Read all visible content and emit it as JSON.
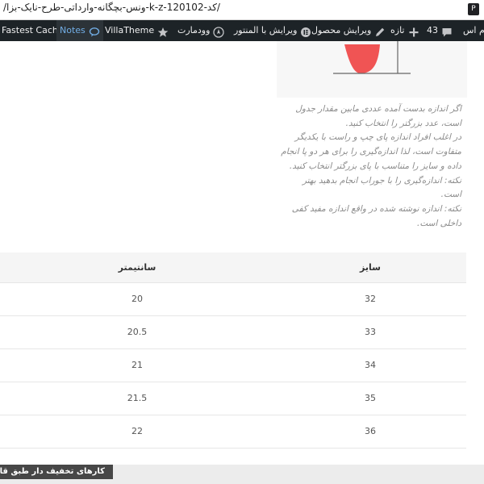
{
  "browser": {
    "url": "/کد-120102-k-z-ونس-بچگانه-وارداتی-طرح-نایک-بزا/"
  },
  "adminbar": {
    "items": [
      {
        "label": "Fastest Cache",
        "icon": ""
      },
      {
        "label": "Notes",
        "icon": "speech-bubble-icon"
      },
      {
        "label": "VillaTheme",
        "icon": "star-icon"
      },
      {
        "label": "وودمارت",
        "icon": "compass-icon"
      },
      {
        "label": "ویرایش با المنتور",
        "icon": "elementor-icon"
      },
      {
        "label": "ویرایش محصول",
        "icon": "pencil-icon"
      },
      {
        "label": "تازه",
        "icon": "plus-icon"
      },
      {
        "label": "43",
        "icon": "comment-icon"
      },
      {
        "label": "ام اس",
        "icon": ""
      }
    ]
  },
  "description": [
    "اگر اندازه بدست آمده عددی مابین مقدار جدول",
    "است، عدد بزرگتر را انتخاب کنید.",
    "در اغلب افراد اندازه پای چپ و راست با یکدیگر",
    "متفاوت است، لذا اندازه‌گیری را برای هر دو پا انجام",
    "داده و سایز را متناسب با پای بزرگتر انتخاب کنید.",
    "نکته: اندازه‌گیری را با جوراب انجام بدهید بهتر",
    "است.",
    "نکته: اندازه نوشته شده در واقع اندازه مفید کفی",
    "داخلی است."
  ],
  "table": {
    "headers": {
      "size": "سایز",
      "cm": "سانتیمتر"
    },
    "rows": [
      {
        "size": "32",
        "cm": "20"
      },
      {
        "size": "33",
        "cm": "20.5"
      },
      {
        "size": "34",
        "cm": "21"
      },
      {
        "size": "35",
        "cm": "21.5"
      },
      {
        "size": "36",
        "cm": "22"
      }
    ]
  },
  "footer": {
    "tag": "کارهای تخفیف دار طبق قانو"
  },
  "colors": {
    "adminbar": "#1d2327",
    "notes_text": "#72aee6",
    "shoe_red": "#f05454"
  }
}
